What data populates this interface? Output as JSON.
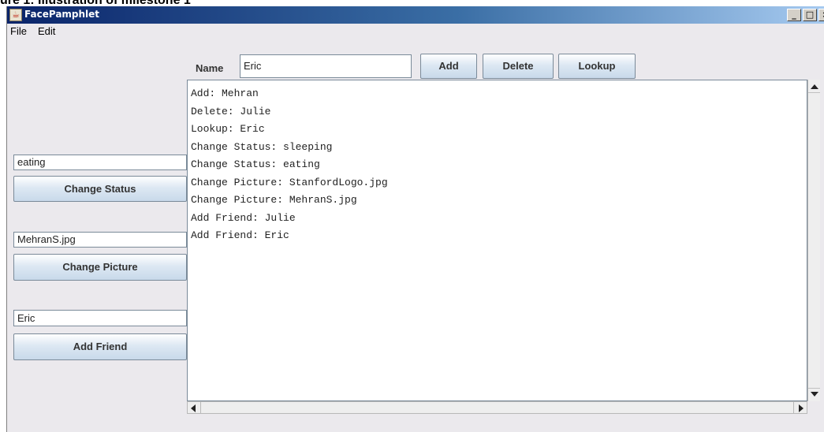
{
  "caption": "ure 1: Illustration of milestone 1",
  "window": {
    "title": "FacePamphlet",
    "controls": {
      "minimize": "_",
      "maximize": "□",
      "close": "×"
    }
  },
  "menu": {
    "file": "File",
    "edit": "Edit"
  },
  "toolbar": {
    "name_label": "Name",
    "name_value": "Eric",
    "add_label": "Add",
    "delete_label": "Delete",
    "lookup_label": "Lookup"
  },
  "sidebar": {
    "status_value": "eating",
    "change_status_label": "Change Status",
    "picture_value": "MehranS.jpg",
    "change_picture_label": "Change Picture",
    "friend_value": "Eric",
    "add_friend_label": "Add Friend"
  },
  "log": [
    "Add: Mehran",
    "Delete: Julie",
    "Lookup: Eric",
    "Change Status: sleeping",
    "Change Status: eating",
    "Change Picture: StanfordLogo.jpg",
    "Change Picture: MehranS.jpg",
    "Add Friend: Julie",
    "Add Friend: Eric"
  ]
}
